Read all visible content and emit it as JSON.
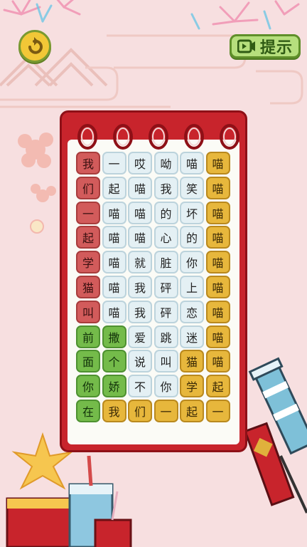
{
  "hint_button": {
    "label": "提示",
    "icon": "video-icon"
  },
  "back_button": {
    "icon": "back-arrow-icon"
  },
  "colors": {
    "red": "#d25b5b",
    "gold": "#e7b73c",
    "green": "#74bb4a",
    "white": "#e4f0f4",
    "board": "#c8242c"
  },
  "grid": {
    "rows": [
      [
        {
          "t": "我",
          "c": "red"
        },
        {
          "t": "一",
          "c": "white"
        },
        {
          "t": "哎",
          "c": "white"
        },
        {
          "t": "呦",
          "c": "white"
        },
        {
          "t": "喵",
          "c": "white"
        },
        {
          "t": "喵",
          "c": "gold"
        }
      ],
      [
        {
          "t": "们",
          "c": "red"
        },
        {
          "t": "起",
          "c": "white"
        },
        {
          "t": "喵",
          "c": "white"
        },
        {
          "t": "我",
          "c": "white"
        },
        {
          "t": "笑",
          "c": "white"
        },
        {
          "t": "喵",
          "c": "gold"
        }
      ],
      [
        {
          "t": "一",
          "c": "red"
        },
        {
          "t": "喵",
          "c": "white"
        },
        {
          "t": "喵",
          "c": "white"
        },
        {
          "t": "的",
          "c": "white"
        },
        {
          "t": "坏",
          "c": "white"
        },
        {
          "t": "喵",
          "c": "gold"
        }
      ],
      [
        {
          "t": "起",
          "c": "red"
        },
        {
          "t": "喵",
          "c": "white"
        },
        {
          "t": "喵",
          "c": "white"
        },
        {
          "t": "心",
          "c": "white"
        },
        {
          "t": "的",
          "c": "white"
        },
        {
          "t": "喵",
          "c": "gold"
        }
      ],
      [
        {
          "t": "学",
          "c": "red"
        },
        {
          "t": "喵",
          "c": "white"
        },
        {
          "t": "就",
          "c": "white"
        },
        {
          "t": "脏",
          "c": "white"
        },
        {
          "t": "你",
          "c": "white"
        },
        {
          "t": "喵",
          "c": "gold"
        }
      ],
      [
        {
          "t": "猫",
          "c": "red"
        },
        {
          "t": "喵",
          "c": "white"
        },
        {
          "t": "我",
          "c": "white"
        },
        {
          "t": "砰",
          "c": "white"
        },
        {
          "t": "上",
          "c": "white"
        },
        {
          "t": "喵",
          "c": "gold"
        }
      ],
      [
        {
          "t": "叫",
          "c": "red"
        },
        {
          "t": "喵",
          "c": "white"
        },
        {
          "t": "我",
          "c": "white"
        },
        {
          "t": "砰",
          "c": "white"
        },
        {
          "t": "恋",
          "c": "white"
        },
        {
          "t": "喵",
          "c": "gold"
        }
      ],
      [
        {
          "t": "前",
          "c": "green"
        },
        {
          "t": "撒",
          "c": "green"
        },
        {
          "t": "爱",
          "c": "white"
        },
        {
          "t": "跳",
          "c": "white"
        },
        {
          "t": "迷",
          "c": "white"
        },
        {
          "t": "喵",
          "c": "gold"
        }
      ],
      [
        {
          "t": "面",
          "c": "green"
        },
        {
          "t": "个",
          "c": "green"
        },
        {
          "t": "说",
          "c": "white"
        },
        {
          "t": "叫",
          "c": "white"
        },
        {
          "t": "猫",
          "c": "gold"
        },
        {
          "t": "喵",
          "c": "gold"
        }
      ],
      [
        {
          "t": "你",
          "c": "green"
        },
        {
          "t": "娇",
          "c": "green"
        },
        {
          "t": "不",
          "c": "white"
        },
        {
          "t": "你",
          "c": "white"
        },
        {
          "t": "学",
          "c": "gold"
        },
        {
          "t": "起",
          "c": "gold"
        }
      ],
      [
        {
          "t": "在",
          "c": "green"
        },
        {
          "t": "我",
          "c": "gold"
        },
        {
          "t": "们",
          "c": "gold"
        },
        {
          "t": "一",
          "c": "gold"
        },
        {
          "t": "起",
          "c": "gold"
        },
        {
          "t": "一",
          "c": "gold"
        }
      ]
    ]
  }
}
